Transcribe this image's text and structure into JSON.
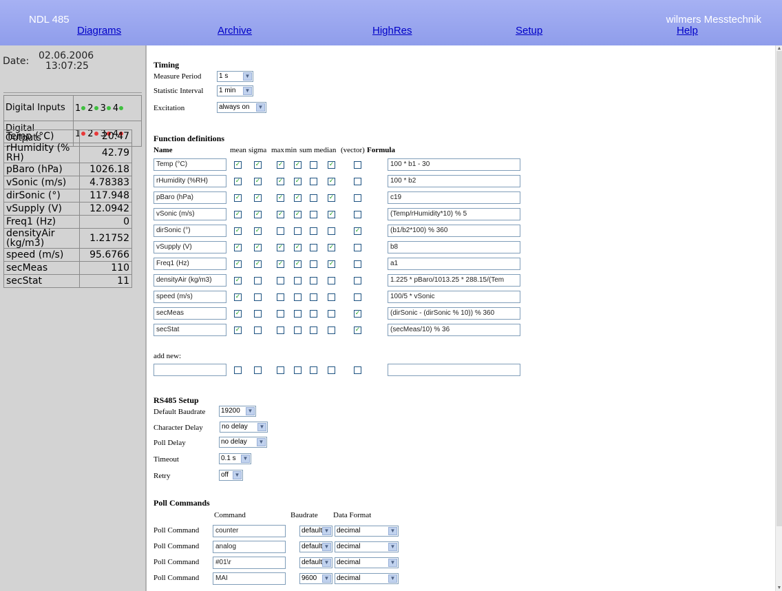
{
  "header": {
    "brand_left": "NDL 485",
    "brand_right": "wilmers Messtechnik",
    "nav": [
      "Diagrams",
      "Archive",
      "HighRes",
      "Setup",
      "Help"
    ]
  },
  "sidebar": {
    "date_label": "Date:",
    "date": "02.06.2006",
    "time": "13:07:25",
    "digital_inputs_label": "Digital Inputs",
    "digital_outputs_label": "Digital Outputs",
    "channel_numbers": [
      "1",
      "2",
      "3",
      "4"
    ],
    "input_color": "#3fbf3f",
    "output_color": "#e83a3a",
    "sensors": [
      {
        "name": "Temp (°C)",
        "value": "20.47"
      },
      {
        "name": "rHumidity (% RH)",
        "value": "42.79"
      },
      {
        "name": "pBaro (hPa)",
        "value": "1026.18"
      },
      {
        "name": "vSonic (m/s)",
        "value": "4.78383"
      },
      {
        "name": "dirSonic (°)",
        "value": "117.948"
      },
      {
        "name": "vSupply (V)",
        "value": "12.0942"
      },
      {
        "name": "Freq1 (Hz)",
        "value": "0"
      },
      {
        "name": "densityAir (kg/m3)",
        "value": "1.21752"
      },
      {
        "name": "speed (m/s)",
        "value": "95.6766"
      },
      {
        "name": "secMeas",
        "value": "110"
      },
      {
        "name": "secStat",
        "value": "11"
      }
    ]
  },
  "timing": {
    "title": "Timing",
    "measure_period_label": "Measure Period",
    "measure_period": "1 s",
    "statistic_interval_label": "Statistic Interval",
    "statistic_interval": "1 min",
    "excitation_label": "Excitation",
    "excitation": "always on"
  },
  "functions": {
    "title": "Function definitions",
    "name_header": "Name",
    "stat_headers": [
      "mean",
      "sigma",
      "max",
      "min",
      "sum",
      "median",
      "(vector)"
    ],
    "formula_header": "Formula",
    "rows": [
      {
        "name": "Temp (°C)",
        "flags": [
          1,
          1,
          1,
          1,
          0,
          1,
          0
        ],
        "formula": "100 * b1 - 30"
      },
      {
        "name": "rHumidity (%RH)",
        "flags": [
          1,
          1,
          1,
          1,
          0,
          1,
          0
        ],
        "formula": "100 * b2"
      },
      {
        "name": "pBaro (hPa)",
        "flags": [
          1,
          1,
          1,
          1,
          0,
          1,
          0
        ],
        "formula": "c19"
      },
      {
        "name": "vSonic (m/s)",
        "flags": [
          1,
          1,
          1,
          1,
          0,
          1,
          0
        ],
        "formula": "(Temp/rHumidity*10) % 5"
      },
      {
        "name": "dirSonic (°)",
        "flags": [
          1,
          1,
          0,
          0,
          0,
          0,
          1
        ],
        "formula": "(b1/b2*100) % 360"
      },
      {
        "name": "vSupply (V)",
        "flags": [
          1,
          1,
          1,
          1,
          0,
          1,
          0
        ],
        "formula": "b8"
      },
      {
        "name": "Freq1 (Hz)",
        "flags": [
          1,
          1,
          1,
          1,
          0,
          1,
          0
        ],
        "formula": "a1"
      },
      {
        "name": "densityAir (kg/m3)",
        "flags": [
          1,
          0,
          0,
          0,
          0,
          0,
          0
        ],
        "formula": "1.225 * pBaro/1013.25 * 288.15/(Tem"
      },
      {
        "name": "speed (m/s)",
        "flags": [
          1,
          0,
          0,
          0,
          0,
          0,
          0
        ],
        "formula": "100/5 * vSonic"
      },
      {
        "name": "secMeas",
        "flags": [
          1,
          0,
          0,
          0,
          0,
          0,
          1
        ],
        "formula": "(dirSonic - (dirSonic % 10)) % 360"
      },
      {
        "name": "secStat",
        "flags": [
          1,
          0,
          0,
          0,
          0,
          0,
          1
        ],
        "formula": "(secMeas/10) % 36"
      }
    ],
    "add_new_label": "add new:",
    "add_new_name": "",
    "add_new_formula": ""
  },
  "rs485": {
    "title": "RS485 Setup",
    "default_baudrate_label": "Default Baudrate",
    "default_baudrate": "19200",
    "character_delay_label": "Character Delay",
    "character_delay": "no delay",
    "poll_delay_label": "Poll Delay",
    "poll_delay": "no delay",
    "timeout_label": "Timeout",
    "timeout": "0.1 s",
    "retry_label": "Retry",
    "retry": "off"
  },
  "poll": {
    "title": "Poll Commands",
    "command_header": "Command",
    "baudrate_header": "Baudrate",
    "format_header": "Data Format",
    "row_label": "Poll Command",
    "rows": [
      {
        "command": "counter",
        "baudrate": "default",
        "format": "decimal"
      },
      {
        "command": "analog",
        "baudrate": "default",
        "format": "decimal"
      },
      {
        "command": "#01\\r",
        "baudrate": "default",
        "format": "decimal"
      },
      {
        "command": "MAI",
        "baudrate": "9600",
        "format": "decimal"
      }
    ]
  }
}
